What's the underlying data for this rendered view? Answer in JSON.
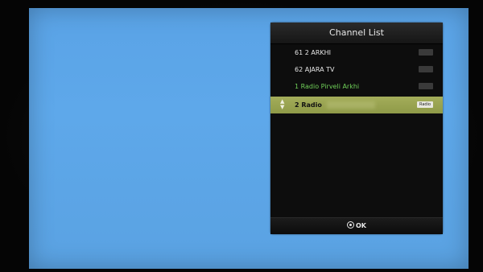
{
  "panel": {
    "title": "Channel List",
    "channels": [
      {
        "name": "61 2 ARKHI",
        "tag": ""
      },
      {
        "name": "62 AJARA TV",
        "tag": ""
      },
      {
        "name": "1 Radio Pirveli Arkhi",
        "tag": ""
      },
      {
        "name": "2 Radio",
        "tag": "Radio"
      }
    ],
    "selected_index": 3,
    "selection_arrows": [
      "▲",
      "▼"
    ],
    "footer_label": "OK",
    "footer_icon": "ok-button-icon"
  },
  "colors": {
    "screen_background": "#5ea8ea",
    "panel_background": "#0d0d0d",
    "selected_row": "#9aa350",
    "radio_channel_text": "#6fcf58"
  }
}
